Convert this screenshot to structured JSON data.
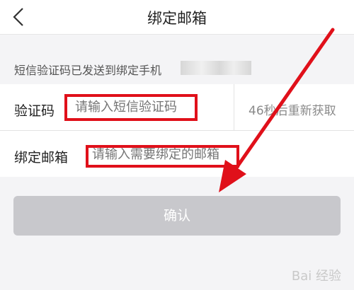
{
  "header": {
    "title": "绑定邮箱"
  },
  "notice": {
    "text": "短信验证码已发送到绑定手机"
  },
  "form": {
    "code_label": "验证码",
    "code_placeholder": "请输入短信验证码",
    "resend_text": "46秒后重新获取",
    "email_label": "绑定邮箱",
    "email_placeholder": "请输入需要绑定的邮箱"
  },
  "confirm_button": {
    "label": "确认"
  },
  "watermark": {
    "text": "Bai 经验"
  },
  "colors": {
    "annotation": "#e0101a",
    "button_disabled": "#c8c8cc"
  }
}
